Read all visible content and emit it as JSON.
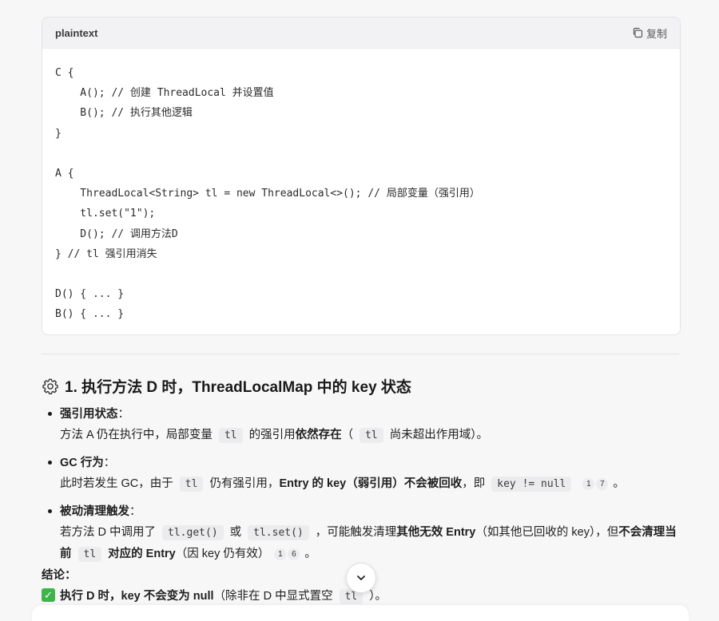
{
  "code_block": {
    "language": "plaintext",
    "copy_label": "复制",
    "lines": [
      "C {",
      "    A(); // 创建 ThreadLocal 并设置值",
      "    B(); // 执行其他逻辑",
      "}",
      "",
      "A {",
      "    ThreadLocal<String> tl = new ThreadLocal<>(); // 局部变量（强引用）",
      "    tl.set(\"1\");",
      "    D(); // 调用方法D",
      "} // tl 强引用消失",
      "",
      "D() { ... }",
      "B() { ... }"
    ]
  },
  "section": {
    "title": "1. 执行方法 D 时，ThreadLocalMap 中的 key 状态",
    "icon": "gear-icon"
  },
  "bullets": [
    {
      "title": "强引用状态",
      "parts": [
        "方法 A 仍在执行中，局部变量",
        "tl",
        "的强引用",
        "依然存在",
        "（",
        "tl",
        "尚未超出作用域）。"
      ]
    },
    {
      "title": "GC 行为",
      "parts": [
        "此时若发生 GC，由于",
        "tl",
        "仍有强引用，",
        "Entry 的 key（弱引用）不会被回收",
        "，即",
        "key != null",
        "1",
        "7",
        "。"
      ]
    },
    {
      "title": "被动清理触发",
      "parts": [
        "若方法 D 中调用了",
        "tl.get()",
        "或",
        "tl.set()",
        "，可能触发清理",
        "其他无效 Entry",
        "（如其他已回收的 key），但",
        "不会清理当前",
        "tl",
        "对应的 Entry",
        "（因 key 仍有效）",
        "1",
        "6",
        "。"
      ]
    }
  ],
  "conclusion": {
    "label": "结论",
    "parts": [
      "执行 D 时，key ",
      "不会变为 null",
      "（除非在 D 中显式置空",
      "tl",
      "）。"
    ]
  },
  "colors": {
    "check": "#3fb44a",
    "inline_code_bg": "#ececee"
  }
}
